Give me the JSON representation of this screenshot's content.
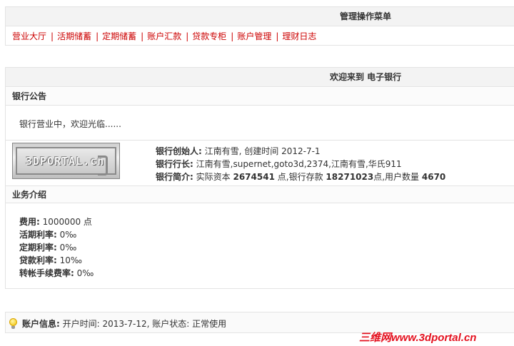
{
  "menu": {
    "title": "管理操作菜单",
    "items": [
      {
        "label": "营业大厅"
      },
      {
        "label": "活期储蓄"
      },
      {
        "label": "定期储蓄"
      },
      {
        "label": "账户汇款"
      },
      {
        "label": "贷款专柜"
      },
      {
        "label": "账户管理"
      },
      {
        "label": "理财日志"
      }
    ],
    "separator": "|"
  },
  "welcome": {
    "title": "欢迎来到 电子银行",
    "notice_header": "银行公告",
    "notice_text": "银行营业中，欢迎光临......",
    "logo_text": "3DPORTAL.cn",
    "founder_label": "银行创始人:",
    "founder_value": "江南有雪, 创建时间 2012-7-1",
    "president_label": "银行行长:",
    "president_value": "江南有雪,supernet,goto3d,2374,江南有雪,华氏911",
    "intro_label": "银行简介:",
    "intro_capital_text": "实际资本",
    "intro_capital_value": "2674541",
    "intro_deposit_text": "点,银行存款",
    "intro_deposit_value": "18271023",
    "intro_users_text": "点,用户数量",
    "intro_users_value": "4670",
    "business_header": "业务介绍",
    "business": [
      {
        "label": "费用:",
        "value": "1000000 点"
      },
      {
        "label": "活期利率:",
        "value": "0‰"
      },
      {
        "label": "定期利率:",
        "value": "0‰"
      },
      {
        "label": "贷款利率:",
        "value": "10‰"
      },
      {
        "label": "转帐手续费率:",
        "value": "0‰"
      }
    ]
  },
  "account": {
    "label": "账户信息:",
    "value": "开户时间: 2013-7-12, 账户状态: 正常使用",
    "icon": "lightbulb-icon"
  },
  "watermark": "三维网www.3dportal.cn",
  "colors": {
    "menu_link": "#cc0000",
    "watermark": "#e4101e",
    "header_bg": "#f3f3f3"
  }
}
